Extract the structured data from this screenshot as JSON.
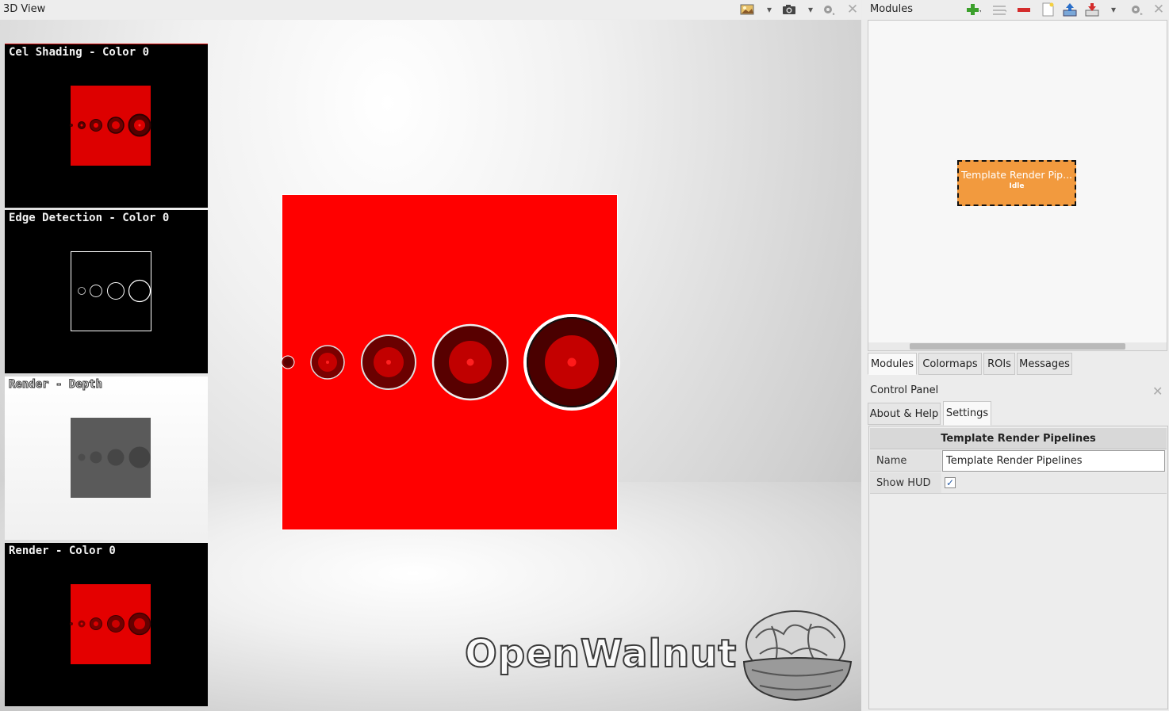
{
  "view": {
    "title": "3D View",
    "thumbnails": [
      {
        "label": "Cel Shading - Color 0",
        "bg": "#000000",
        "kind": "cel"
      },
      {
        "label": "Edge Detection - Color 0",
        "bg": "#000000",
        "kind": "edge"
      },
      {
        "label": "Render - Depth",
        "bg": "#ffffff",
        "kind": "depth"
      },
      {
        "label": "Render - Color 0",
        "bg": "#000000",
        "kind": "color"
      }
    ],
    "brand_text": "OpenWalnut"
  },
  "modules": {
    "title": "Modules",
    "node": {
      "title": "Template Render Pip...",
      "status": "Idle"
    },
    "tabs": [
      "Modules",
      "Colormaps",
      "ROIs",
      "Messages"
    ],
    "active_tab": "Modules"
  },
  "control_panel": {
    "title": "Control Panel",
    "tabs": [
      "About & Help",
      "Settings"
    ],
    "active_tab": "Settings",
    "header": "Template Render Pipelines",
    "name_label": "Name",
    "name_value": "Template Render Pipelines",
    "hud_label": "Show HUD",
    "hud_checked": true
  },
  "colors": {
    "accent_red": "#ff0000",
    "node_orange": "#f29a3e"
  },
  "icons": [
    "screenshot-background-icon",
    "camera-icon",
    "gear-icon",
    "close-icon",
    "add-module-icon",
    "remove-module-icon",
    "new-project-icon",
    "load-icon",
    "save-icon"
  ]
}
